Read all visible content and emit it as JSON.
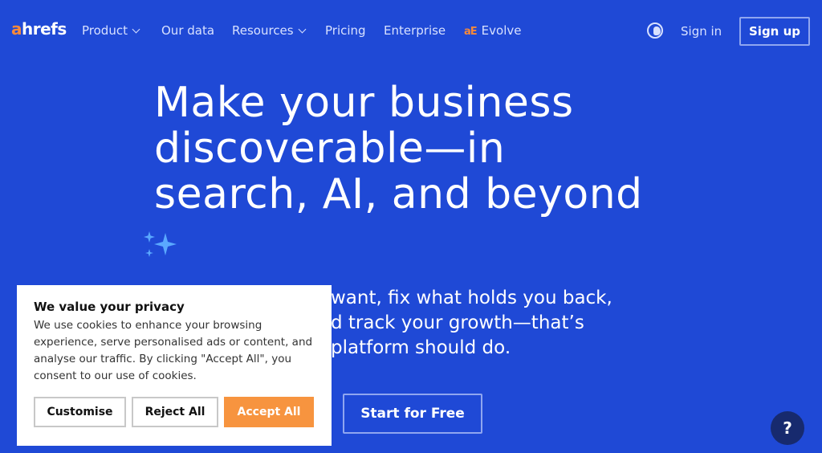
{
  "nav": {
    "logo": {
      "accent": "a",
      "rest": "hrefs"
    },
    "items": [
      {
        "label": "Product",
        "has_menu": true
      },
      {
        "label": "Our data",
        "has_menu": false
      },
      {
        "label": "Resources",
        "has_menu": true
      },
      {
        "label": "Pricing",
        "has_menu": false
      },
      {
        "label": "Enterprise",
        "has_menu": false
      }
    ],
    "evolve": {
      "mark": "aE",
      "label": "Evolve"
    },
    "signin": "Sign in",
    "signup": "Sign up"
  },
  "hero": {
    "title_lines": [
      "Make your business",
      "discoverable—in",
      "search, AI, and beyond"
    ],
    "subtitle_lines": [
      "want, fix what holds you back,",
      "d track your growth—that’s",
      "platform should do."
    ],
    "cta": "Start for Free"
  },
  "cookie": {
    "title": "We value your privacy",
    "body": "We use cookies to enhance your browsing experience, serve personalised ads or content, and analyse our traffic. By clicking \"Accept All\", you consent to our use of cookies.",
    "customise": "Customise",
    "reject": "Reject All",
    "accept": "Accept All"
  },
  "help": "?",
  "colors": {
    "background": "#1f49d6",
    "brand_orange": "#f7893a",
    "accept": "#f7943f",
    "help_bg": "#172a6e"
  },
  "icons": [
    "chevron-down-icon",
    "globe-icon",
    "sparkles-icon",
    "help-icon"
  ]
}
